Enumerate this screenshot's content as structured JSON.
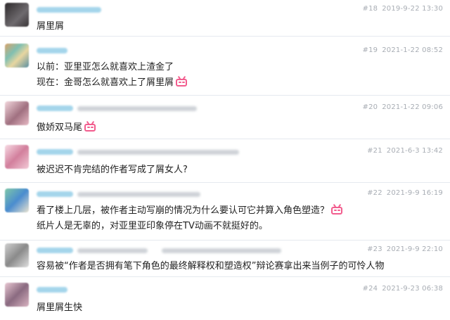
{
  "colors": {
    "accent": "#f25d8e",
    "username_blur": "#8ecbe6",
    "meta_text": "#a8adb4",
    "divider": "#e5e9ef"
  },
  "comments": [
    {
      "floor": "#18",
      "time": "2019-9-22 13:30",
      "lines": [
        "屑里屑"
      ],
      "avatar_colors": [
        "#3c3838",
        "#6e6a6e"
      ]
    },
    {
      "floor": "#19",
      "time": "2021-1-22 08:52",
      "lines": [
        "以前：亚里亚怎么就喜欢上渣金了",
        "现在：金哥怎么就喜欢上了屑里屑"
      ],
      "emote_icon": "bilibili-tv-icon",
      "avatar_colors": [
        "#7fbfb1",
        "#e0a070"
      ]
    },
    {
      "floor": "#20",
      "time": "2021-1-22 09:06",
      "lines": [
        "傲娇双马尾"
      ],
      "emote_icon": "bilibili-tv-icon",
      "avatar_colors": [
        "#e6b8c3",
        "#a07080"
      ]
    },
    {
      "floor": "#21",
      "time": "2021-6-3 13:42",
      "lines": [
        "被迟迟不肯完结的作者写成了屑女人?"
      ],
      "avatar_colors": [
        "#f2c9d6",
        "#d27f9c"
      ]
    },
    {
      "floor": "#22",
      "time": "2021-9-9 16:19",
      "lines": [
        "看了楼上几层，被作者主动写崩的情况为什么要认可它并算入角色塑造？",
        "纸片人是无辜的，对亚里亚印象停在TV动画不就挺好的。"
      ],
      "emote_icon": "bilibili-tv-icon",
      "avatar_colors": [
        "#7ec7a8",
        "#4a8ccf"
      ]
    },
    {
      "floor": "#23",
      "time": "2021-9-9 22:10",
      "lines": [
        "容易被“作者是否拥有笔下角色的最终解释权和塑造权”辩论赛拿出来当例子的可怜人物"
      ],
      "avatar_colors": [
        "#8a8a8a",
        "#cfcfcf"
      ]
    },
    {
      "floor": "#24",
      "time": "2021-9-23 06:38",
      "lines": [
        "屑里屑生快"
      ],
      "avatar_colors": [
        "#d8b2c0",
        "#8a6a80"
      ]
    }
  ]
}
